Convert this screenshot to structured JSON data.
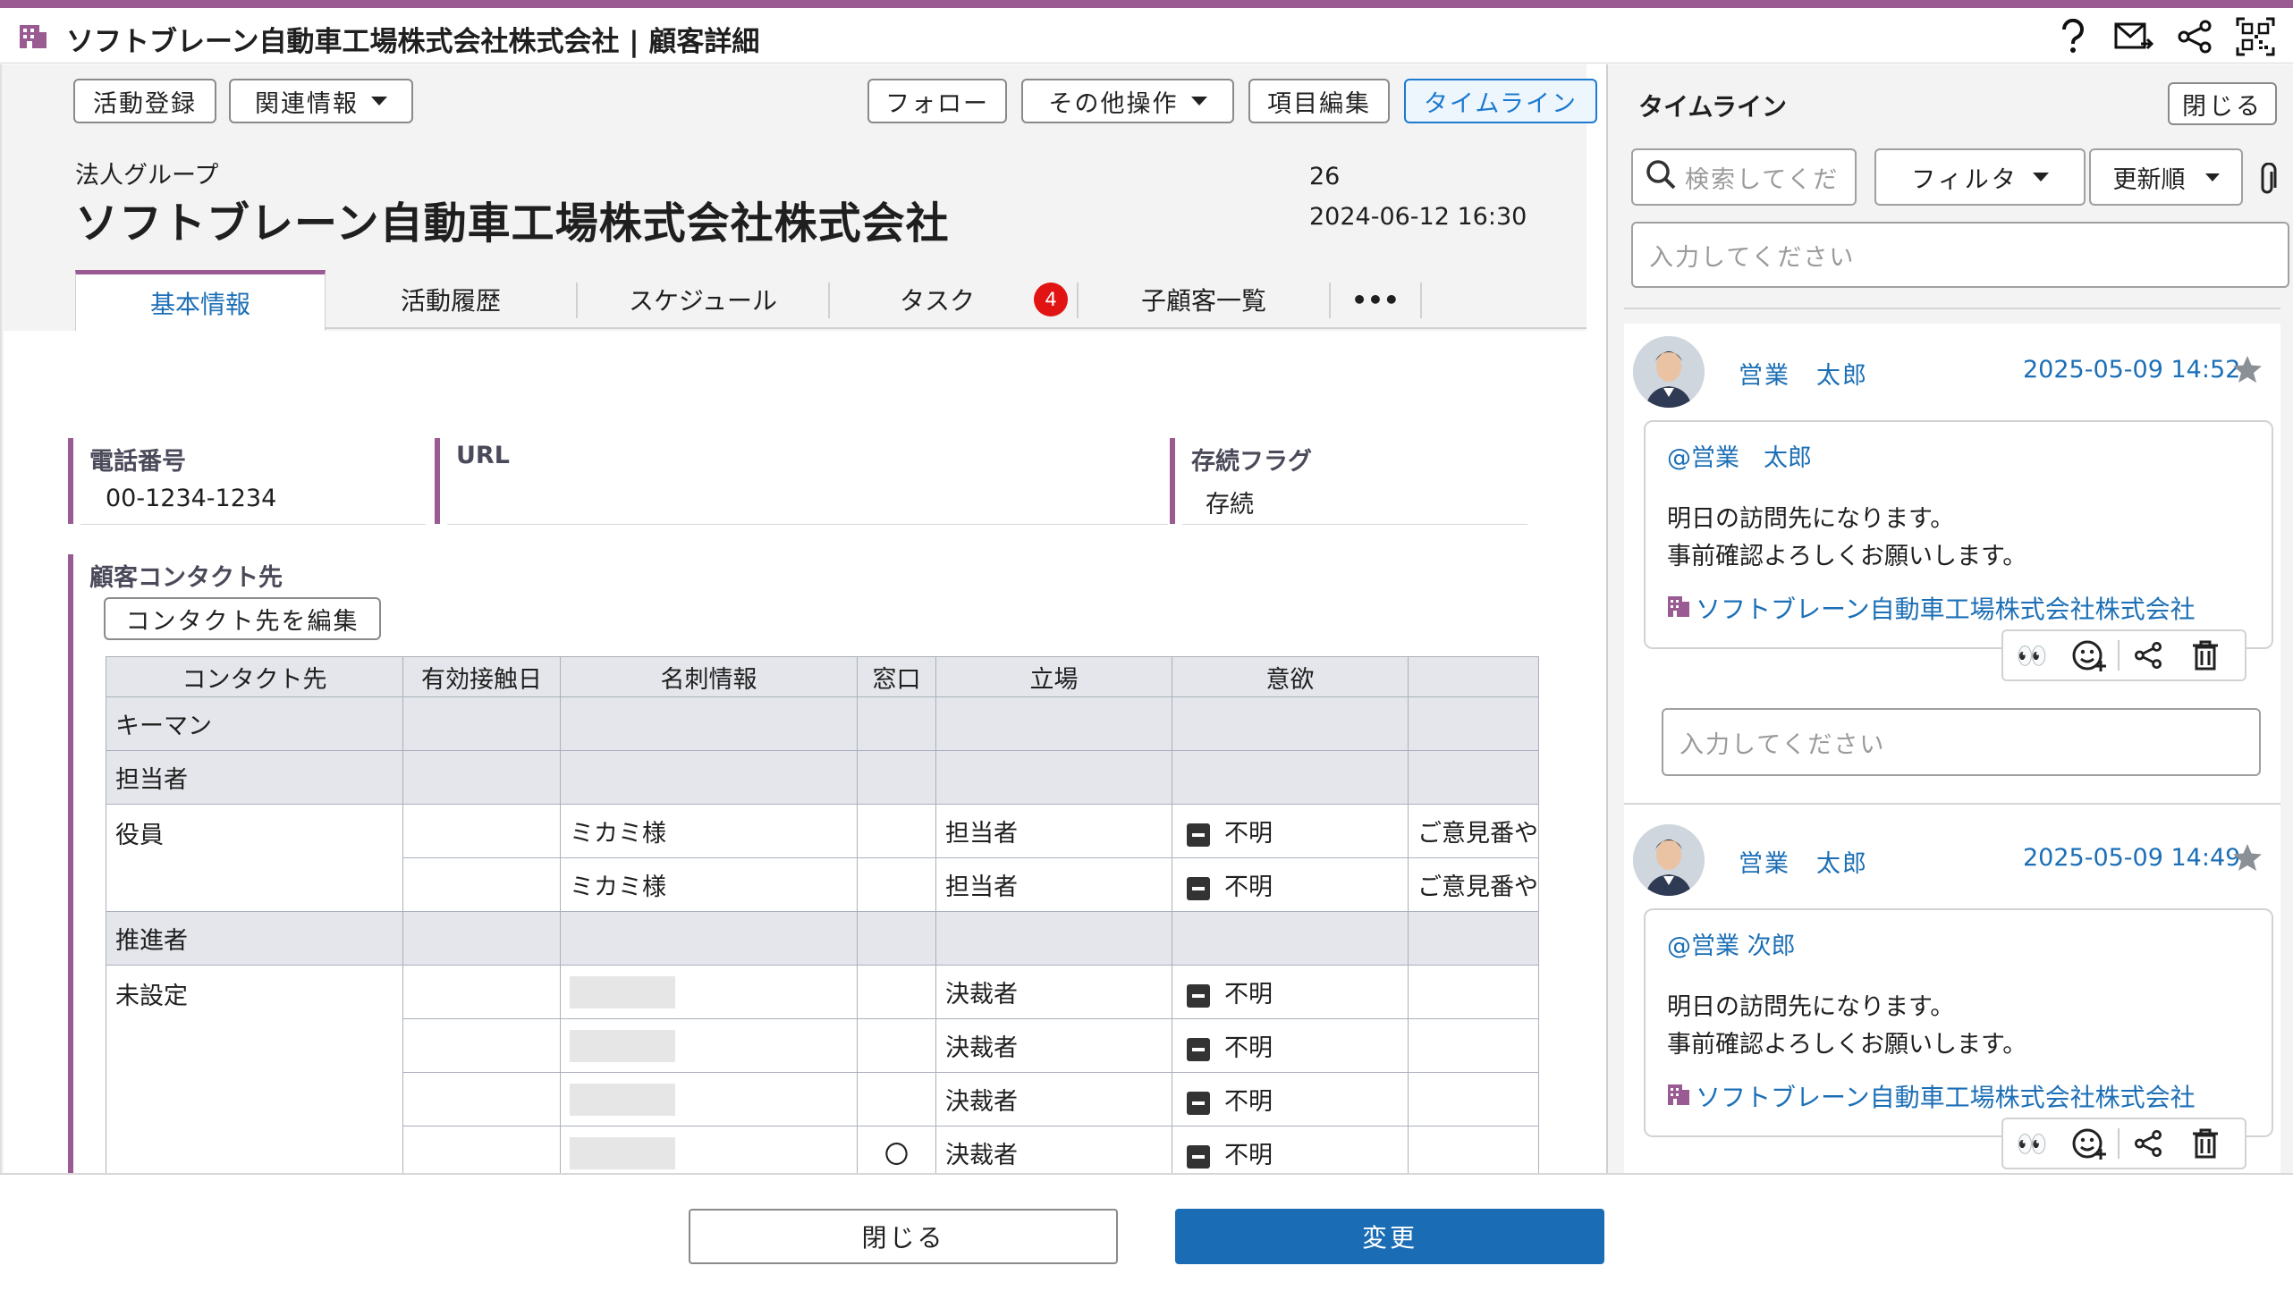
{
  "window": {
    "title": "ソフトブレーン自動車工場株式会社株式会社 | 顧客詳細",
    "accent": "#9a5b92",
    "link_color": "#1c6fb6"
  },
  "toolbar": {
    "activity_register": "活動登録",
    "related_info": "関連情報",
    "follow": "フォロー",
    "other_ops": "その他操作",
    "edit_items": "項目編集",
    "timeline": "タイムライン"
  },
  "header": {
    "group_label": "法人グループ",
    "customer_name": "ソフトブレーン自動車工場株式会社株式会社",
    "meta_number": "26",
    "meta_datetime": "2024-06-12 16:30"
  },
  "tabs": [
    {
      "label": "基本情報",
      "active": true
    },
    {
      "label": "活動履歴"
    },
    {
      "label": "スケジュール"
    },
    {
      "label": "タスク",
      "badge": "4"
    },
    {
      "label": "子顧客一覧"
    },
    {
      "label": "•••"
    }
  ],
  "fields": {
    "phone": {
      "label": "電話番号",
      "value": "00-1234-1234"
    },
    "url": {
      "label": "URL",
      "value": ""
    },
    "survival": {
      "label": "存続フラグ",
      "value": "存続"
    }
  },
  "contacts": {
    "section_label": "顧客コンタクト先",
    "edit_button": "コンタクト先を編集",
    "columns": [
      "コンタクト先",
      "有効接触日",
      "名刺情報",
      "窓口",
      "立場",
      "意欲",
      ""
    ],
    "groups": {
      "keyman": "キーマン",
      "tantou": "担当者",
      "yakuin": "役員",
      "suishin": "推進者",
      "mi_settei": "未設定"
    },
    "rows": {
      "yakuin1": {
        "card": "ミカミ様",
        "position": "担当者",
        "motivation": "不明",
        "extra": "ご意見番や"
      },
      "yakuin2": {
        "card": "ミカミ様",
        "position": "担当者",
        "motivation": "不明",
        "extra": "ご意見番や"
      },
      "mi1": {
        "position": "決裁者",
        "motivation": "不明"
      },
      "mi2": {
        "position": "決裁者",
        "motivation": "不明"
      },
      "mi3": {
        "position": "決裁者",
        "motivation": "不明"
      },
      "mi4": {
        "window": "〇",
        "position": "決裁者",
        "motivation": "不明"
      }
    }
  },
  "footer": {
    "close": "閉じる",
    "change": "変更",
    "change_color": "#1a6db5"
  },
  "timeline": {
    "title": "タイムライン",
    "close": "閉じる",
    "search_placeholder": "検索してくだ",
    "filter": "フィルタ",
    "sort": "更新順",
    "input_placeholder": "入力してください",
    "posts": [
      {
        "author": "営業　太郎",
        "date": "2025-05-09 14:52",
        "mention": "@営業　太郎",
        "line1": "明日の訪問先になります。",
        "line2": "事前確認よろしくお願いします。",
        "link": "ソフトブレーン自動車工場株式会社株式会社",
        "reply_placeholder": "入力してください"
      },
      {
        "author": "営業　太郎",
        "date": "2025-05-09 14:49",
        "mention": "@営業 次郎",
        "line1": "明日の訪問先になります。",
        "line2": "事前確認よろしくお願いします。",
        "link": "ソフトブレーン自動車工場株式会社株式会社"
      }
    ]
  }
}
